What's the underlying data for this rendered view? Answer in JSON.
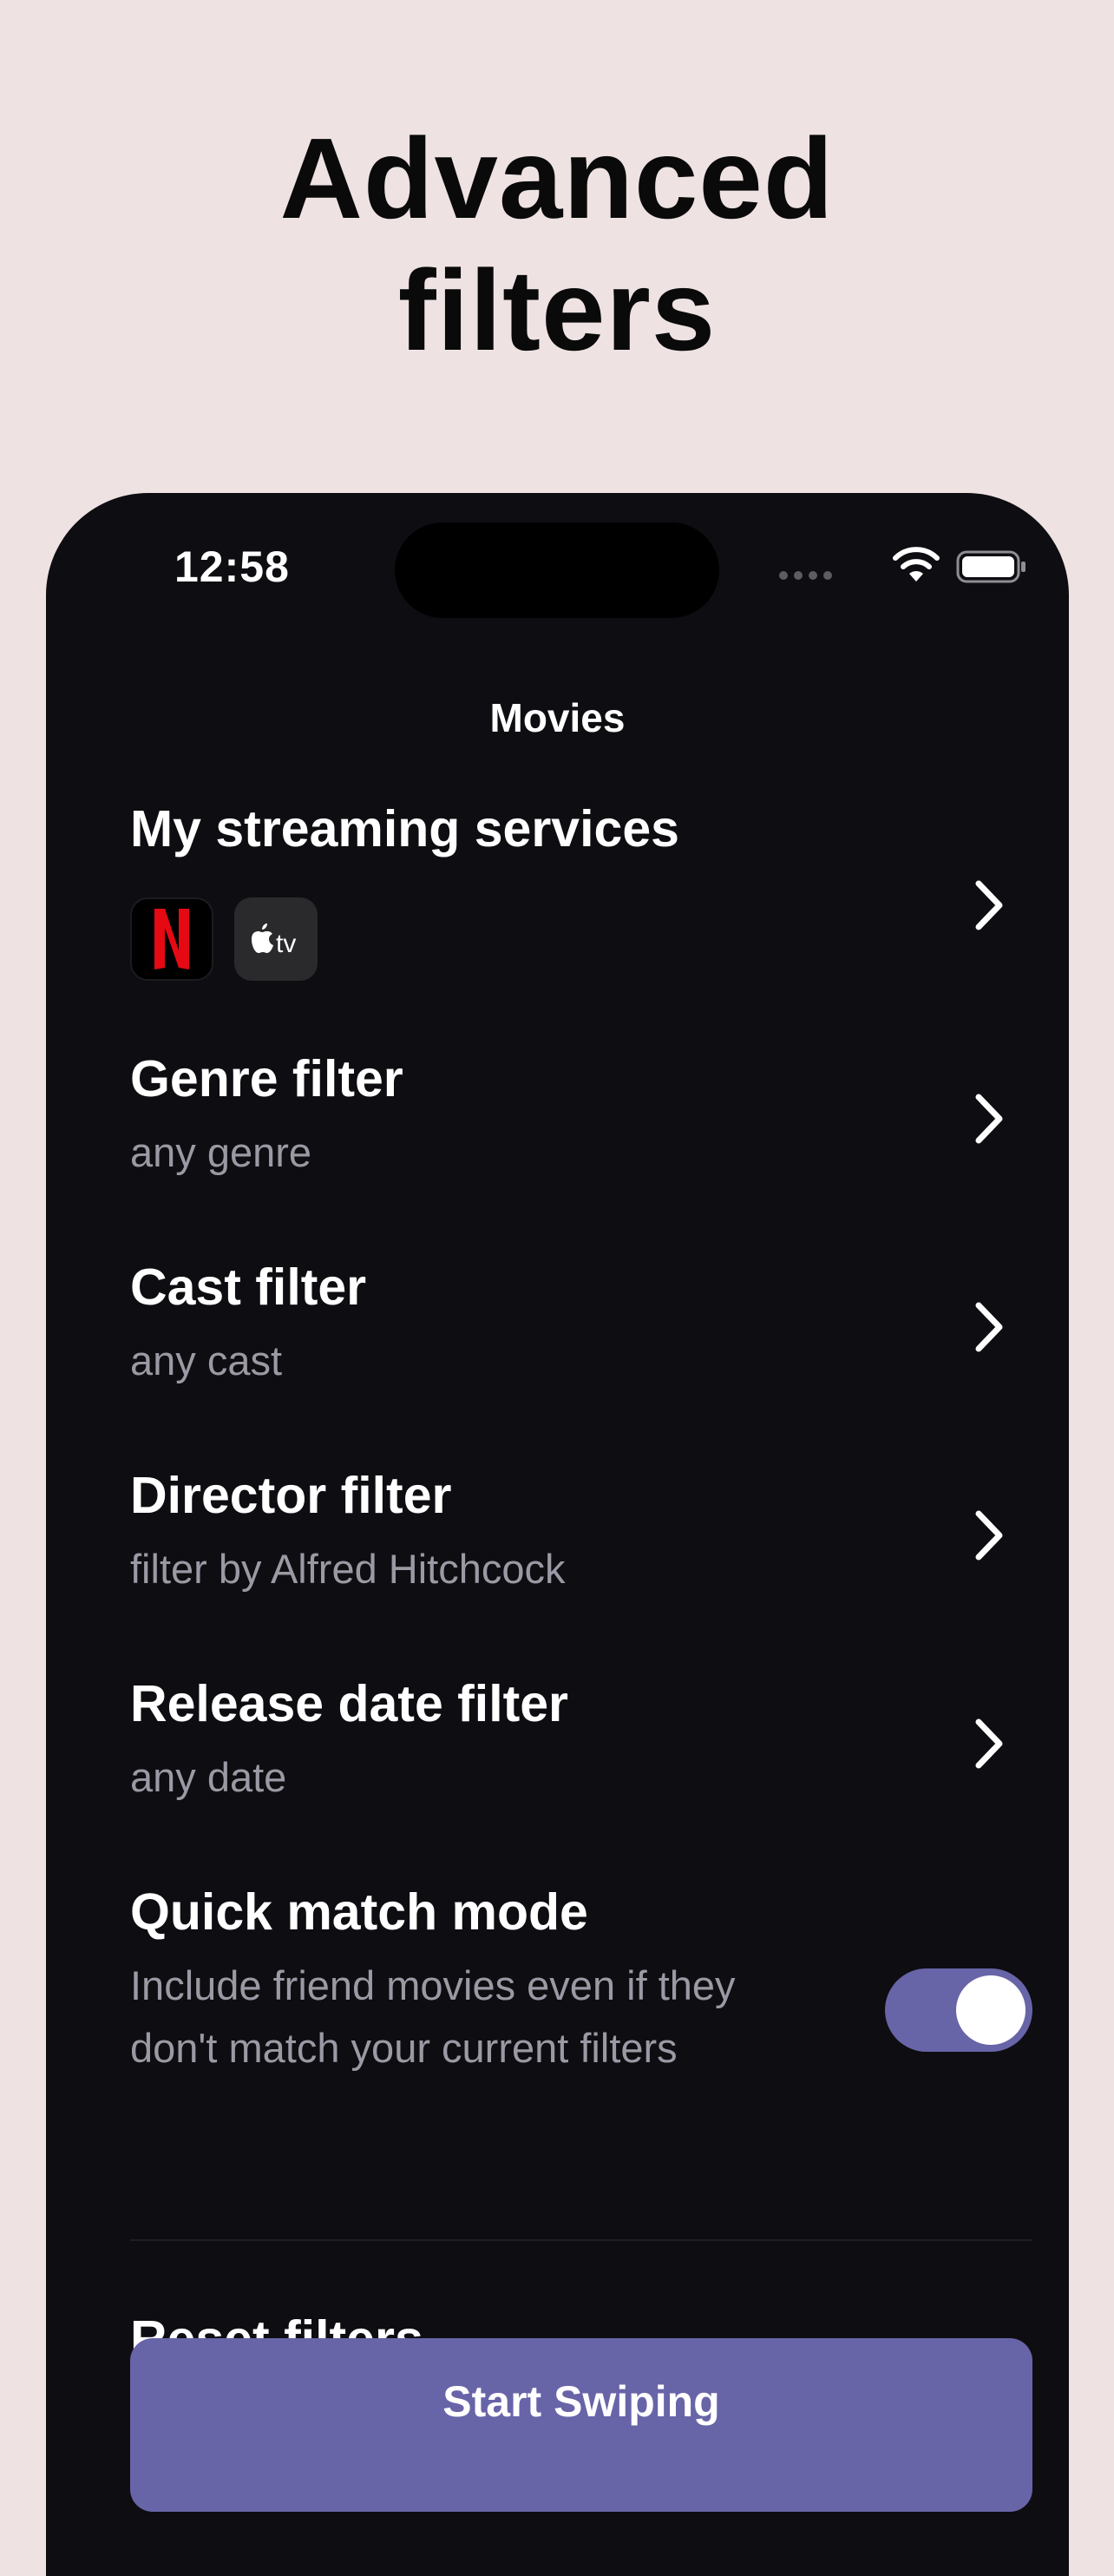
{
  "headline": {
    "line1": "Advanced",
    "line2": "filters"
  },
  "status_bar": {
    "time": "12:58"
  },
  "nav": {
    "title": "Movies"
  },
  "streaming": {
    "title": "My streaming services",
    "services": [
      {
        "name": "Netflix",
        "logo_text": "N",
        "color": "#e50914"
      },
      {
        "name": "Apple TV",
        "logo_text": "tv",
        "color": "#ffffff"
      }
    ]
  },
  "filters": [
    {
      "title": "Genre filter",
      "subtitle": "any genre"
    },
    {
      "title": "Cast filter",
      "subtitle": "any cast"
    },
    {
      "title": "Director filter",
      "subtitle": "filter by Alfred Hitchcock"
    },
    {
      "title": "Release date filter",
      "subtitle": "any date"
    }
  ],
  "quick_match": {
    "title": "Quick match mode",
    "description": "Include friend movies even if they don't match your current filters",
    "enabled": true
  },
  "reset": {
    "label": "Reset filters"
  },
  "cta": {
    "label": "Start Swiping"
  },
  "colors": {
    "page_background": "#eee2e2",
    "screen_background": "#0e0d11",
    "accent": "#6864a8",
    "secondary_text": "#9a99a4"
  }
}
